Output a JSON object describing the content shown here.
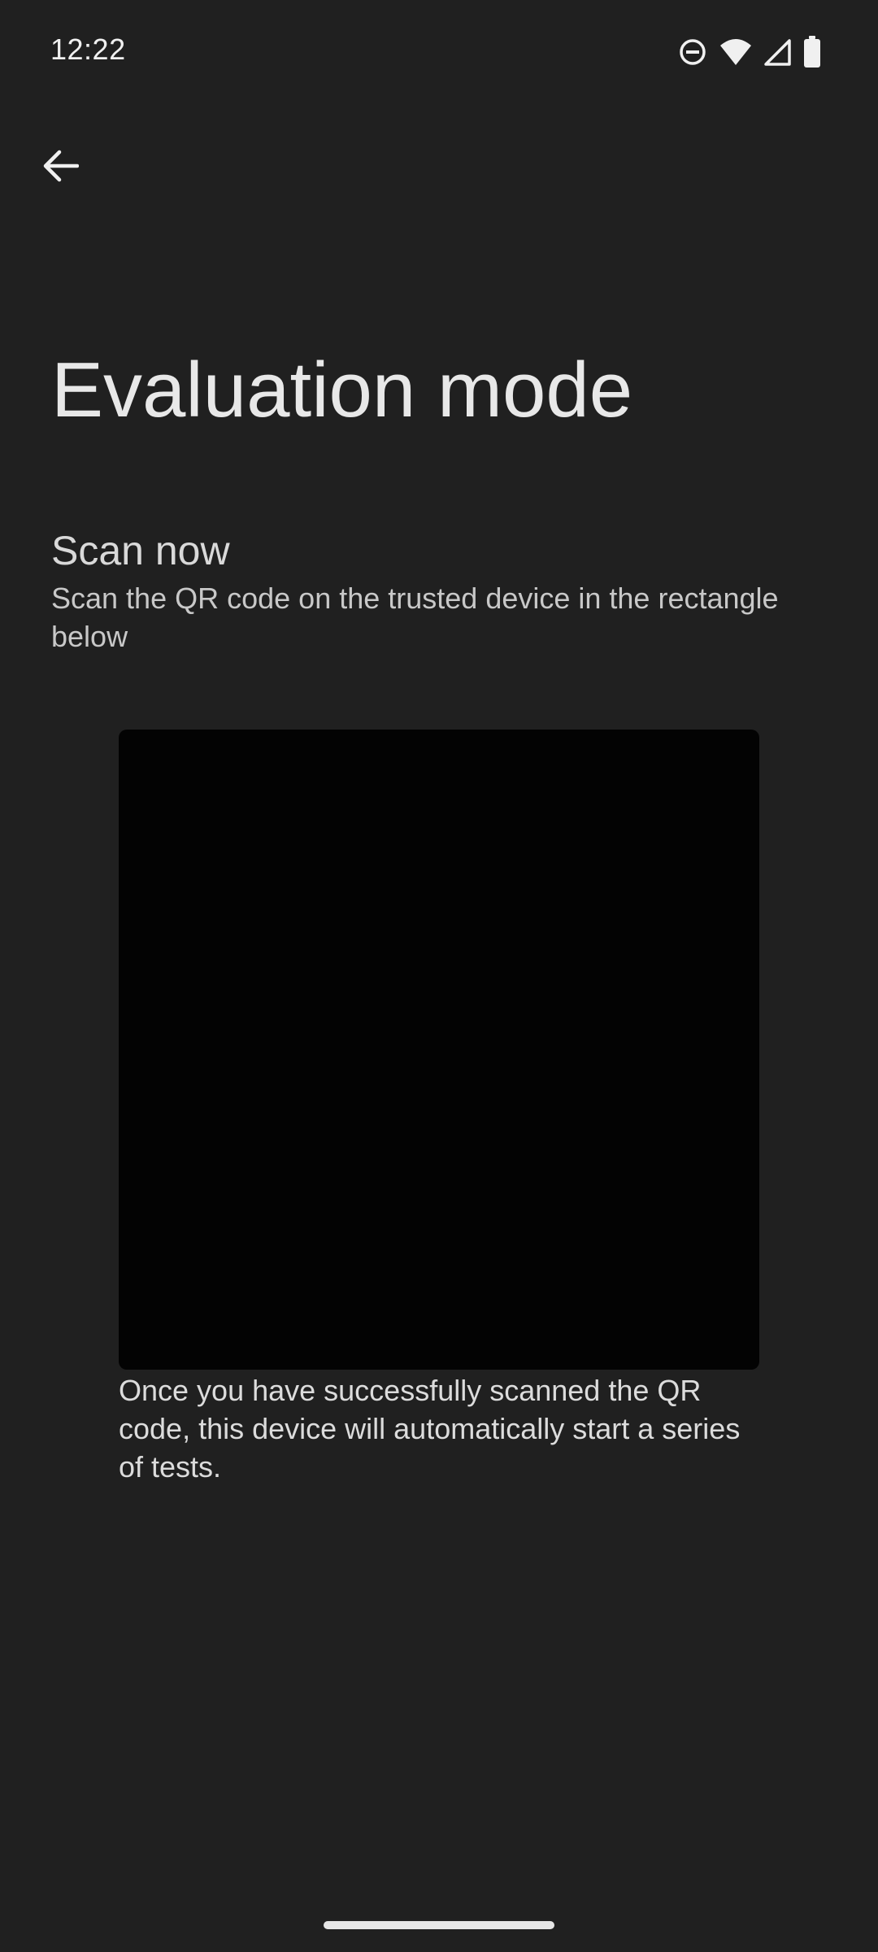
{
  "status_bar": {
    "time": "12:22",
    "icons": [
      "do-not-disturb-icon",
      "wifi-icon",
      "cell-signal-icon",
      "battery-icon"
    ]
  },
  "nav": {
    "back_icon": "arrow-left-icon"
  },
  "page": {
    "title": "Evaluation mode",
    "section_heading": "Scan now",
    "section_body": "Scan the QR code on the trusted device in the rectangle below",
    "footer_text": "Once you have successfully scanned the QR code, this device will automatically start a series of tests."
  },
  "colors": {
    "background": "#202020",
    "camera_view": "#030303",
    "text_primary": "#e8e8e8"
  }
}
